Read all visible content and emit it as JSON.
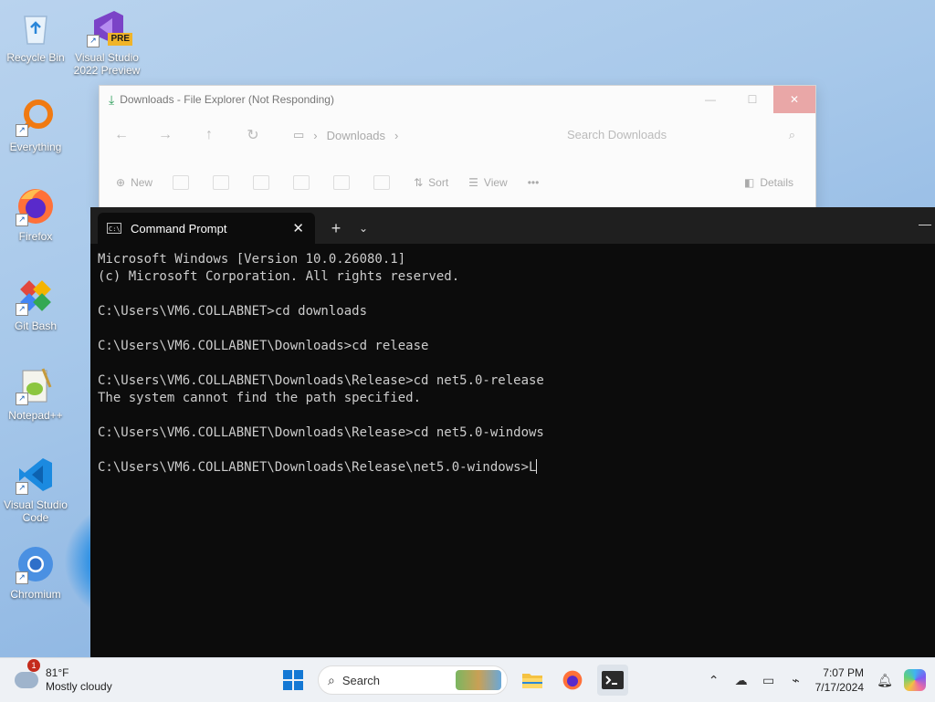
{
  "desktop": {
    "icons": [
      {
        "label": "Recycle Bin",
        "icon": "recycle-bin-icon"
      },
      {
        "label": "Visual Studio 2022 Preview",
        "icon": "visual-studio-icon",
        "badge": "PRE"
      },
      {
        "label": "Everything",
        "icon": "everything-search-icon"
      },
      {
        "label": "Firefox",
        "icon": "firefox-icon"
      },
      {
        "label": "Git Bash",
        "icon": "git-bash-icon"
      },
      {
        "label": "Notepad++",
        "icon": "notepadpp-icon"
      },
      {
        "label": "Visual Studio Code",
        "icon": "vscode-icon"
      },
      {
        "label": "Chromium",
        "icon": "chromium-icon"
      }
    ]
  },
  "explorer": {
    "title": "Downloads - File Explorer (Not Responding)",
    "address": "Downloads",
    "search_placeholder": "Search Downloads",
    "commands": {
      "new": "New",
      "sort": "Sort",
      "view": "View",
      "more": "•••",
      "details": "Details"
    }
  },
  "terminal": {
    "tab_title": "Command Prompt",
    "lines": [
      "Microsoft Windows [Version 10.0.26080.1]",
      "(c) Microsoft Corporation. All rights reserved.",
      "",
      "C:\\Users\\VM6.COLLABNET>cd downloads",
      "",
      "C:\\Users\\VM6.COLLABNET\\Downloads>cd release",
      "",
      "C:\\Users\\VM6.COLLABNET\\Downloads\\Release>cd net5.0-release",
      "The system cannot find the path specified.",
      "",
      "C:\\Users\\VM6.COLLABNET\\Downloads\\Release>cd net5.0-windows",
      "",
      "C:\\Users\\VM6.COLLABNET\\Downloads\\Release\\net5.0-windows>L"
    ]
  },
  "taskbar": {
    "weather": {
      "temp": "81°F",
      "condition": "Mostly cloudy",
      "badge": "1"
    },
    "search_label": "Search",
    "clock": {
      "time": "7:07 PM",
      "date": "7/17/2024"
    }
  },
  "colors": {
    "terminal_bg": "#0c0c0c",
    "terminal_text": "#cccccc",
    "windows_blue": "#1478d4",
    "taskbar_bg": "#eef1f5"
  }
}
